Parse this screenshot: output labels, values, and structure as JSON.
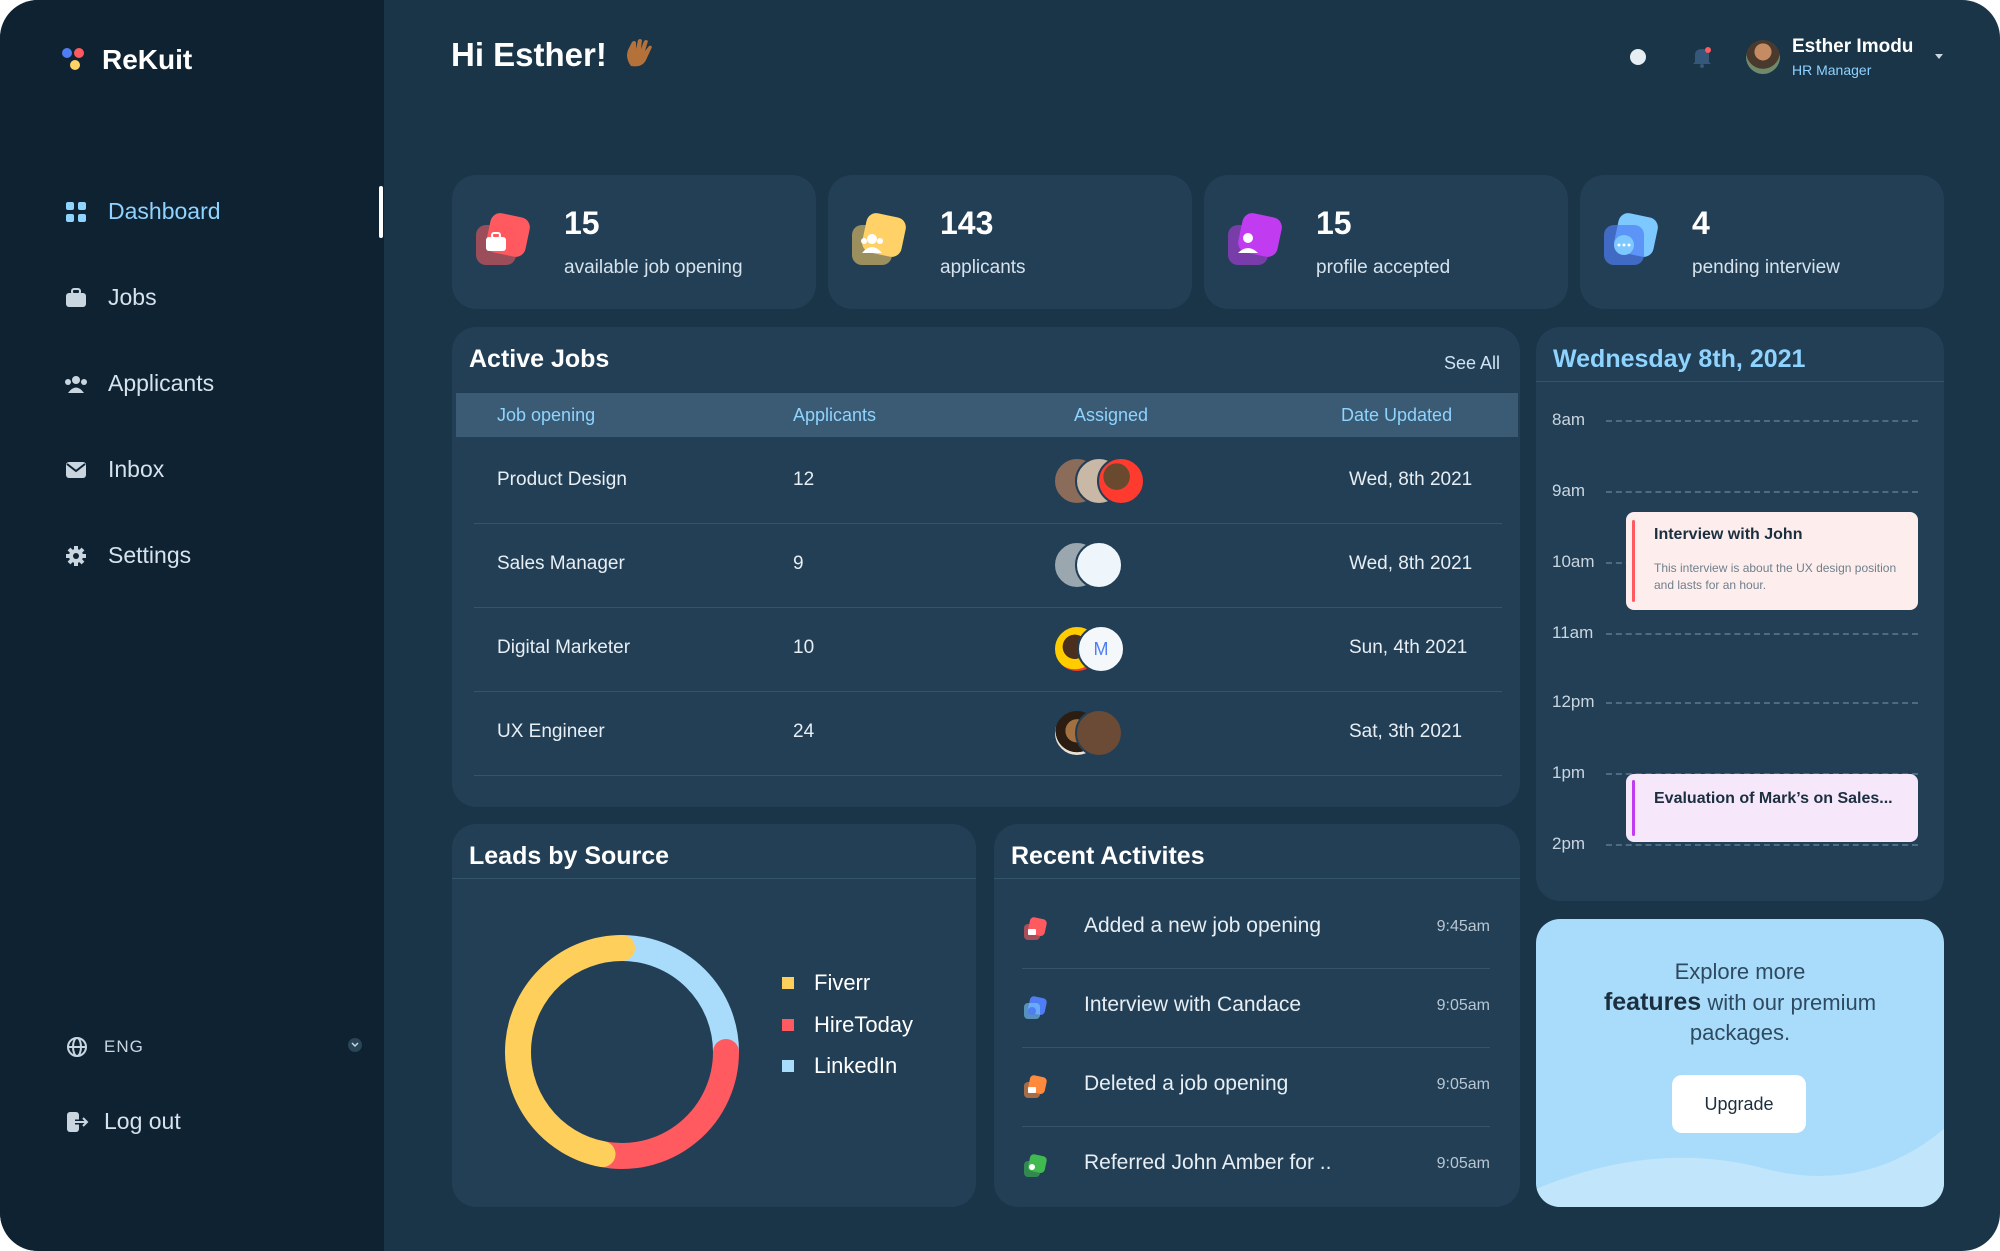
{
  "brand": {
    "name": "ReKuit"
  },
  "header": {
    "greeting": "Hi Esther!",
    "user": {
      "name": "Esther Imodu",
      "role": "HR Manager"
    }
  },
  "sidebar": {
    "items": [
      {
        "label": "Dashboard",
        "icon": "dashboard-icon",
        "active": true
      },
      {
        "label": "Jobs",
        "icon": "briefcase-icon",
        "active": false
      },
      {
        "label": "Applicants",
        "icon": "users-icon",
        "active": false
      },
      {
        "label": "Inbox",
        "icon": "mail-icon",
        "active": false
      },
      {
        "label": "Settings",
        "icon": "gear-icon",
        "active": false
      }
    ],
    "language": "ENG",
    "logout": "Log out"
  },
  "stats": [
    {
      "value": "15",
      "label": "available job opening",
      "color": "#ff5a5f"
    },
    {
      "value": "143",
      "label": "applicants",
      "color": "#ffd166"
    },
    {
      "value": "15",
      "label": "profile accepted",
      "color": "#c13cf0"
    },
    {
      "value": "4",
      "label": "pending interview",
      "color": "#7cc8ff"
    }
  ],
  "active_jobs": {
    "title": "Active Jobs",
    "see_all": "See All",
    "columns": [
      "Job opening",
      "Applicants",
      "Assigned",
      "Date Updated"
    ],
    "rows": [
      {
        "job": "Product Design",
        "applicants": "12",
        "date": "Wed, 8th 2021"
      },
      {
        "job": "Sales Manager",
        "applicants": "9",
        "date": "Wed, 8th 2021"
      },
      {
        "job": "Digital Marketer",
        "applicants": "10",
        "date": "Sun, 4th 2021"
      },
      {
        "job": "UX Engineer",
        "applicants": "24",
        "date": "Sat, 3th 2021"
      }
    ]
  },
  "schedule": {
    "title": "Wednesday 8th, 2021",
    "times": [
      "8am",
      "9am",
      "10am",
      "11am",
      "12pm",
      "1pm",
      "2pm"
    ],
    "events": [
      {
        "title": "Interview with John",
        "desc": "This interview is about the UX design position and lasts for an hour."
      },
      {
        "title": "Evaluation of Mark’s on Sales..."
      }
    ]
  },
  "leads": {
    "title": "Leads by Source"
  },
  "chart_data": {
    "type": "pie",
    "categories": [
      "Fiverr",
      "HireToday",
      "LinkedIn"
    ],
    "values": [
      47,
      28,
      25
    ],
    "colors": [
      "#ffcf5c",
      "#ff5a5f",
      "#a9dcfb"
    ],
    "legend": "right"
  },
  "recent": {
    "title": "Recent Activites",
    "items": [
      {
        "text": "Added a new job opening",
        "time": "9:45am",
        "color": "#ff5a5f"
      },
      {
        "text": "Interview with Candace",
        "time": "9:05am",
        "color": "#4f7df3"
      },
      {
        "text": "Deleted a job opening",
        "time": "9:05am",
        "color": "#ff8a3d"
      },
      {
        "text": "Referred John Amber for ..",
        "time": "9:05am",
        "color": "#3fb950"
      }
    ]
  },
  "promo": {
    "line1": "Explore more",
    "bold": "features",
    "line2": " with our premium packages.",
    "button": "Upgrade"
  }
}
